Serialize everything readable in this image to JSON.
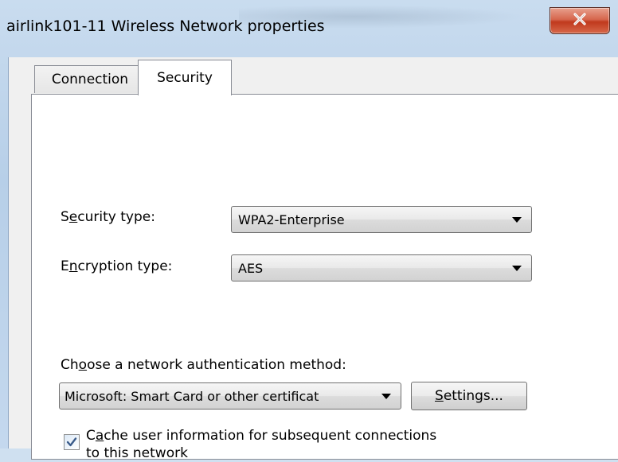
{
  "window": {
    "title": "airlink101-11 Wireless Network properties",
    "close_icon": "close-icon"
  },
  "tabs": [
    {
      "label": "Connection",
      "active": false
    },
    {
      "label": "Security",
      "active": true
    }
  ],
  "security": {
    "security_type_label": {
      "pre": "S",
      "key": "e",
      "post": "curity type:"
    },
    "security_type_value": "WPA2-Enterprise",
    "encryption_type_label": {
      "pre": "E",
      "key": "n",
      "post": "cryption type:"
    },
    "encryption_type_value": "AES",
    "auth_method_label": {
      "pre": "Ch",
      "key": "o",
      "post": "ose a network authentication method:"
    },
    "auth_method_value": "Microsoft: Smart Card or other certificat",
    "settings_button": {
      "pre": "",
      "key": "S",
      "post": "ettings..."
    },
    "cache_checkbox": {
      "checked": true,
      "line1": {
        "pre": "C",
        "key": "a",
        "post": "che user information for subsequent connections"
      },
      "line2": "to this network"
    }
  }
}
